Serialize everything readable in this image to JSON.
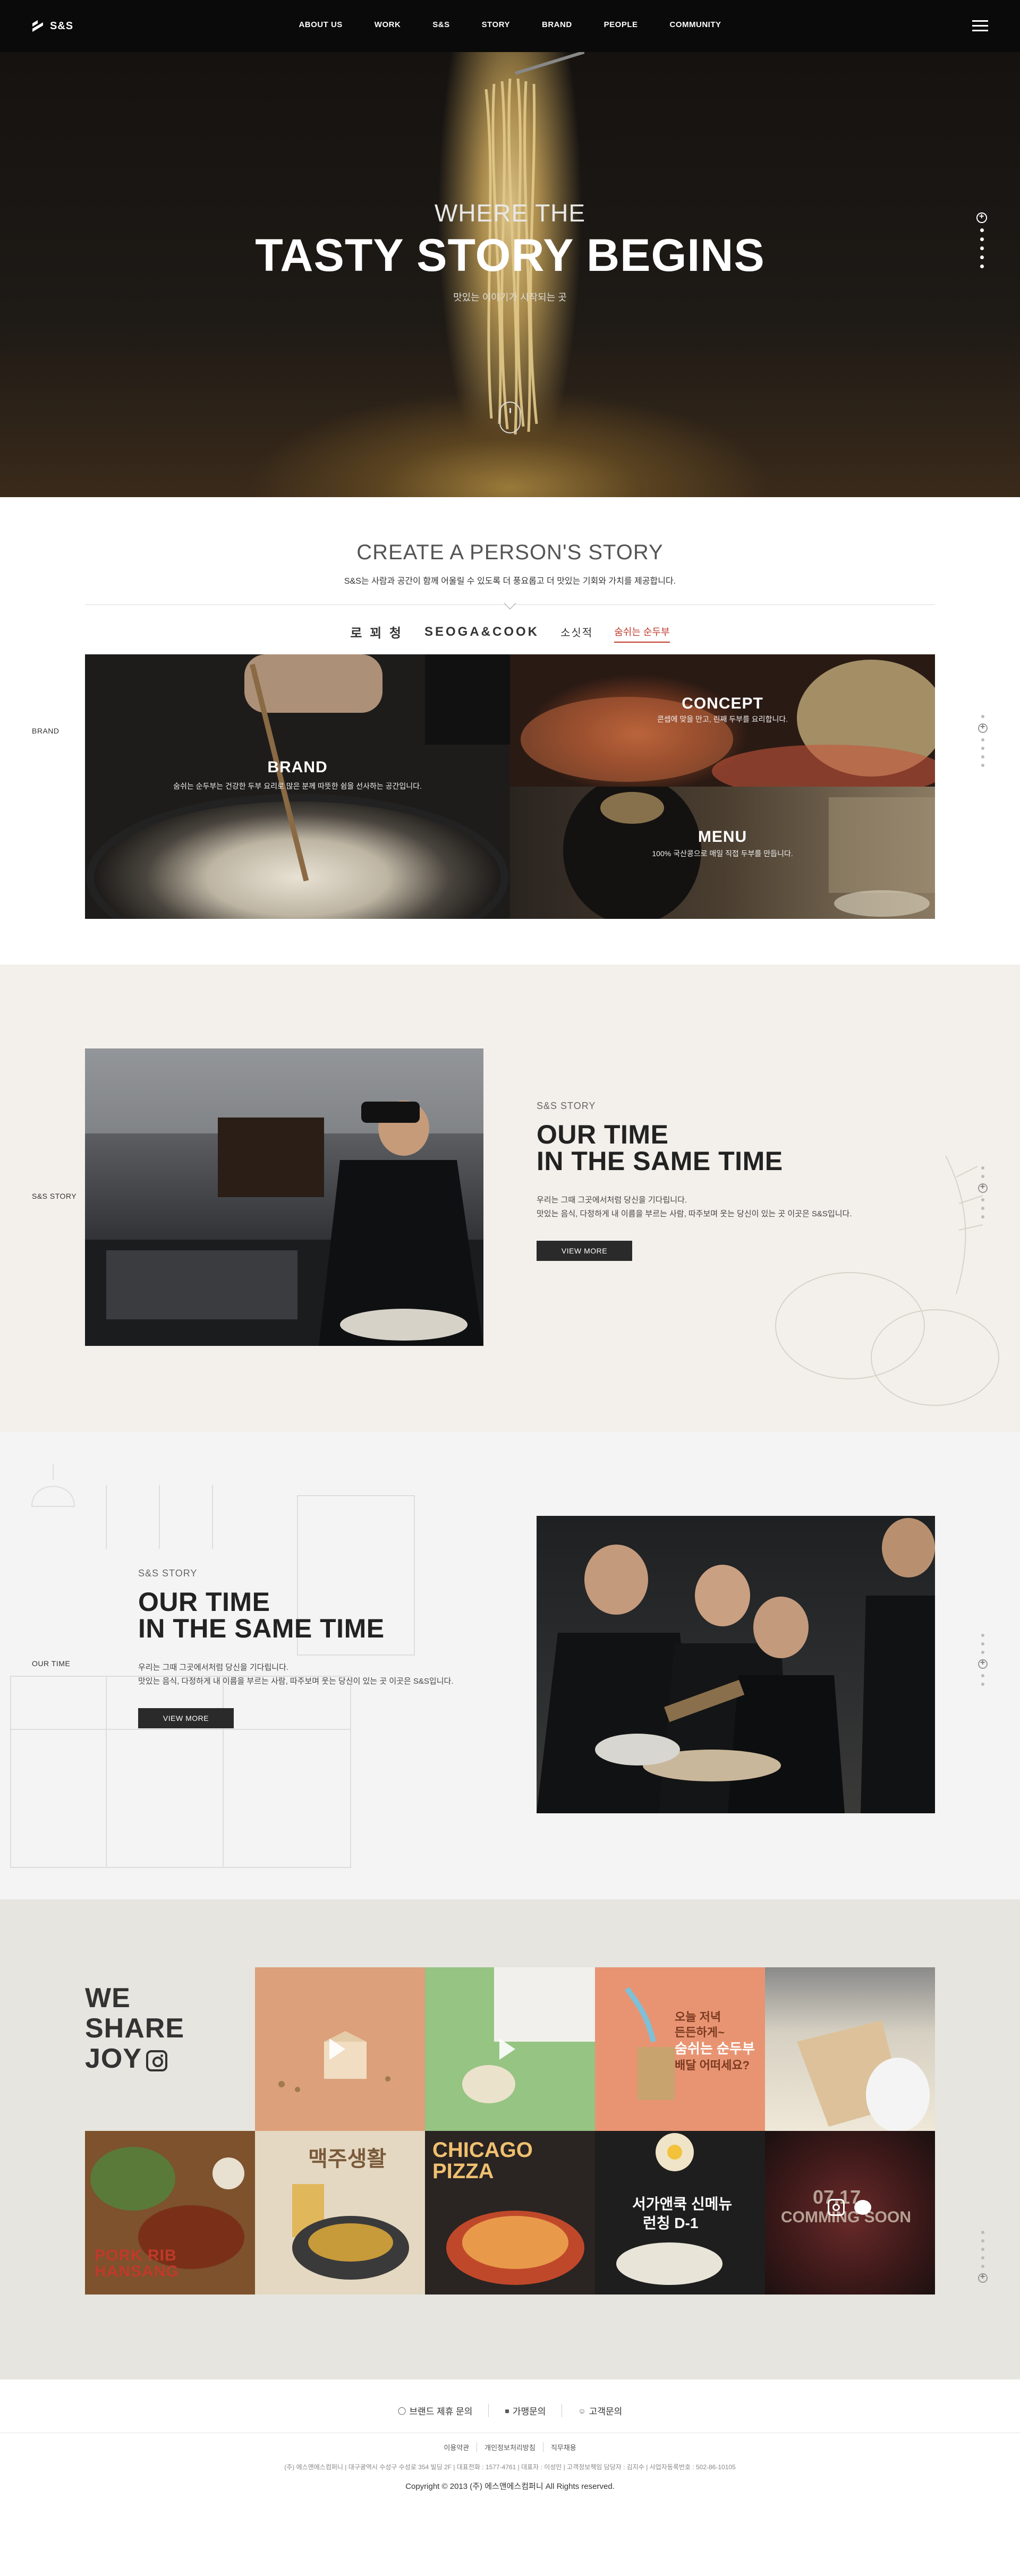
{
  "header": {
    "logo_text": "S&S",
    "nav": [
      "ABOUT US",
      "WORK",
      "S&S",
      "STORY",
      "BRAND",
      "PEOPLE",
      "COMMUNITY"
    ],
    "menu_icon": "hamburger-icon"
  },
  "hero": {
    "subtitle": "WHERE THE",
    "title": "TASTY STORY BEGINS",
    "caption": "맛있는 이야기가 시작되는 곳",
    "scroll_icon": "mouse-scroll-icon"
  },
  "create": {
    "title": "CREATE A PERSON'S STORY",
    "desc": "S&S는 사람과 공간이 함께 어울릴 수 있도록 더 풍요롭고 더 맛있는 기회와 가치를 제공합니다.",
    "brand_tabs": [
      "로 꾀 청",
      "SEOGA&COOK",
      "소싯적",
      "숨쉬는 순두부"
    ],
    "side_label": "BRAND",
    "tiles": {
      "brand": {
        "title": "BRAND",
        "desc": "숨쉬는 순두부는 건강한 두부 요리로 많은 분께 따뜻한 쉼을 선사하는 공간입니다."
      },
      "concept": {
        "title": "CONCEPT",
        "desc": "콘셉에 맞을 만고, 린째 두부를 요리합니다."
      },
      "menu": {
        "title": "MENU",
        "desc": "100% 국산콩으로 매일 직접 두부를 만듭니다."
      }
    }
  },
  "story1": {
    "side_label": "S&S STORY",
    "eyebrow": "S&S STORY",
    "title_line1": "OUR TIME",
    "title_line2": "IN THE SAME TIME",
    "text_line1": "우리는 그때 그곳에서처럼 당신을 기다립니다.",
    "text_line2": "맛있는 음식, 다정하게 내 이름을 부르는 사람, 따주보며 웃는 당신이 있는 곳 이곳은 S&S입니다.",
    "button": "VIEW MORE"
  },
  "story2": {
    "side_label": "OUR TIME",
    "eyebrow": "S&S STORY",
    "title_line1": "OUR TIME",
    "title_line2": "IN THE SAME TIME",
    "text_line1": "우리는 그때 그곳에서처럼 당신을 기다립니다.",
    "text_line2": "맛있는 음식, 다정하게 내 이름을 부르는 사람, 따주보며 웃는 당신이 있는 곳 이곳은 S&S입니다.",
    "button": "VIEW MORE"
  },
  "joy": {
    "title_line1": "WE",
    "title_line2": "SHARE",
    "title_line3": "JOY",
    "posts": {
      "p4_line1": "오늘 저녁",
      "p4_line2": "든든하게~",
      "p4_line3": "숨쉬는 순두부",
      "p4_line4": "배달 어떠세요?",
      "p6_line1": "PORK RIB",
      "p6_line2": "HANSANG",
      "p7": "맥주생활",
      "p8_line1": "CHICAGO",
      "p8_line2": "PIZZA",
      "p9_line1": "서가앤쿡 신메뉴",
      "p9_line2": "런칭 D-1",
      "p10_line1": "07.17",
      "p10_line2": "COMMING SOON"
    }
  },
  "footer": {
    "links": [
      "브랜드 제휴 문의",
      "가맹문의",
      "고객문의"
    ],
    "policy": [
      "이용약관",
      "개인정보처리방침",
      "직무채용"
    ],
    "info": "(주) 에스앤에스컴퍼니 | 대구광역시 수성구 수성로 354 빌딩 2F | 대표전화 : 1577-4761 | 대표자 : 이성민 | 고객정보책임 담당자 : 김지수 | 사업자등록번호 : 502-86-10105",
    "copyright": "Copyright © 2013 (주) 에스앤에스컴퍼니 All Rights reserved."
  },
  "colors": {
    "header_bg": "#0a0a0a",
    "accent_red": "#c0392b",
    "story_bg": "#f3f0eb",
    "joy_bg": "#e6e5df"
  }
}
